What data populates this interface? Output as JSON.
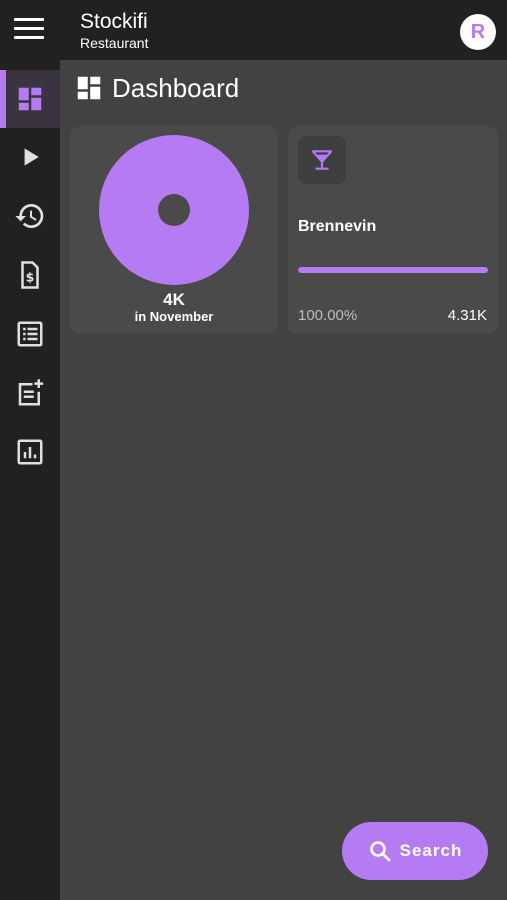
{
  "header": {
    "app_name": "Stockifi",
    "subtitle": "Restaurant",
    "avatar_letter": "R"
  },
  "sidebar": {
    "items": [
      {
        "icon": "dashboard-icon",
        "active": true
      },
      {
        "icon": "play-icon",
        "active": false
      },
      {
        "icon": "history-icon",
        "active": false
      },
      {
        "icon": "invoice-icon",
        "active": false
      },
      {
        "icon": "list-icon",
        "active": false
      },
      {
        "icon": "add-note-icon",
        "active": false
      },
      {
        "icon": "bar-chart-icon",
        "active": false
      }
    ]
  },
  "page": {
    "title": "Dashboard"
  },
  "summary_card": {
    "value": "4K",
    "period": "in November"
  },
  "item_card": {
    "icon": "cocktail-icon",
    "name": "Brennevin",
    "percent_label": "100.00%",
    "value": "4.31K",
    "progress_fraction": 1.0
  },
  "fab": {
    "label": "Search",
    "icon": "search-icon"
  },
  "colors": {
    "accent": "#b57bf2",
    "topbar": "#212121",
    "background": "#424242",
    "card": "#4a4a4a"
  }
}
